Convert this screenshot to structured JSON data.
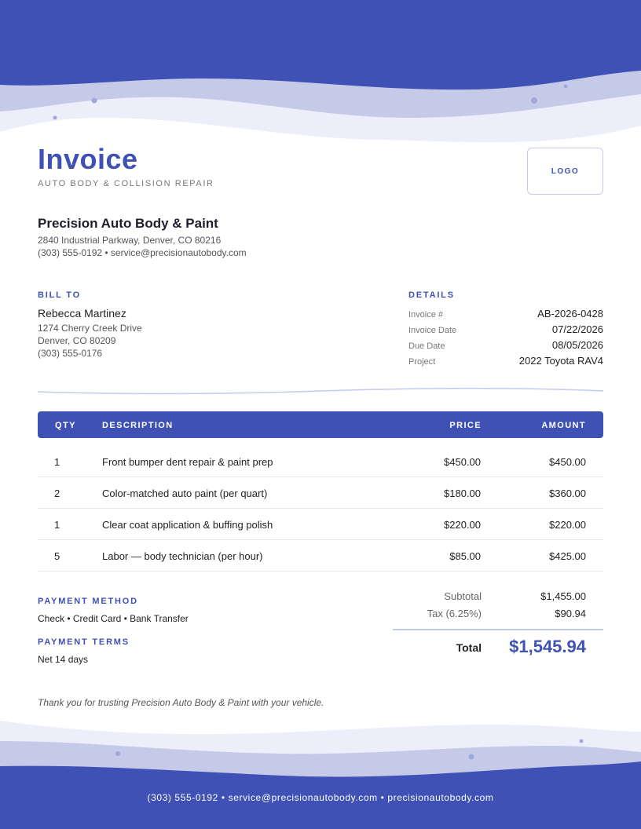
{
  "header": {
    "title": "Invoice",
    "subtitle": "AUTO BODY & COLLISION REPAIR",
    "logo_placeholder": "LOGO"
  },
  "company": {
    "name": "Precision Auto Body & Paint",
    "address": "2840 Industrial Parkway, Denver, CO 80216",
    "contact": "(303) 555-0192 • service@precisionautobody.com"
  },
  "bill_to": {
    "label": "BILL TO",
    "name": "Rebecca Martinez",
    "address_line1": "1274 Cherry Creek Drive",
    "address_line2": "Denver, CO 80209",
    "phone": "(303) 555-0176"
  },
  "details": {
    "label": "DETAILS",
    "rows": [
      {
        "key": "Invoice #",
        "value": "AB-2026-0428"
      },
      {
        "key": "Invoice Date",
        "value": "07/22/2026"
      },
      {
        "key": "Due Date",
        "value": "08/05/2026"
      },
      {
        "key": "Project",
        "value": "2022 Toyota RAV4"
      }
    ]
  },
  "table": {
    "headers": {
      "qty": "QTY",
      "description": "DESCRIPTION",
      "price": "PRICE",
      "amount": "AMOUNT"
    },
    "rows": [
      {
        "qty": "1",
        "description": "Front bumper dent repair & paint prep",
        "price": "$450.00",
        "amount": "$450.00"
      },
      {
        "qty": "2",
        "description": "Color-matched auto paint (per quart)",
        "price": "$180.00",
        "amount": "$360.00"
      },
      {
        "qty": "1",
        "description": "Clear coat application & buffing polish",
        "price": "$220.00",
        "amount": "$220.00"
      },
      {
        "qty": "5",
        "description": "Labor — body technician (per hour)",
        "price": "$85.00",
        "amount": "$425.00"
      }
    ]
  },
  "payment": {
    "method_label": "PAYMENT METHOD",
    "method_value": "Check • Credit Card • Bank Transfer",
    "terms_label": "PAYMENT TERMS",
    "terms_value": "Net 14 days"
  },
  "totals": {
    "subtotal_label": "Subtotal",
    "subtotal_value": "$1,455.00",
    "tax_label": "Tax (6.25%)",
    "tax_value": "$90.94",
    "total_label": "Total",
    "total_value": "$1,545.94"
  },
  "thanks": "Thank you for trusting Precision Auto Body & Paint with your vehicle.",
  "footer": {
    "text": "(303) 555-0192 • service@precisionautobody.com • precisionautobody.com"
  },
  "colors": {
    "accent": "#3f51b5",
    "wave_light": "#c5cae9",
    "wave_lighter": "#eceef9"
  }
}
